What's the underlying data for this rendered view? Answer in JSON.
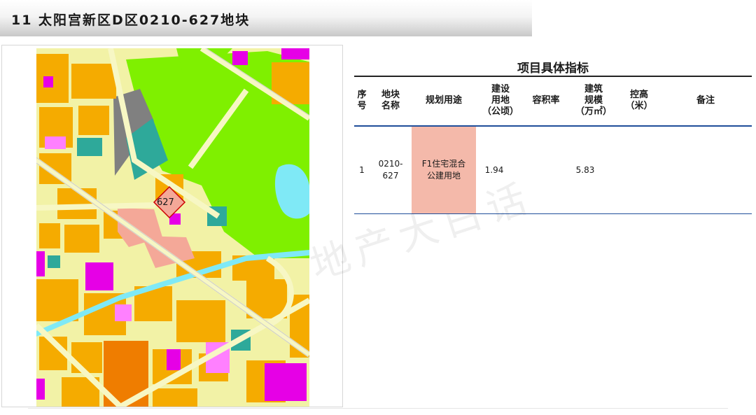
{
  "header": {
    "title": "11  太阳宫新区D区0210-627地块"
  },
  "map": {
    "parcel_label": "627",
    "colors": {
      "residential": "#f5ab00",
      "green_space": "#7ff000",
      "commercial": "#e600e6",
      "mixed_use": "#f4a898",
      "education": "#ff80ff",
      "municipal": "#2ea99a",
      "industrial": "#808080",
      "water": "#7fe9f6",
      "road": "#f2f2a6"
    }
  },
  "watermark": "地产大白话",
  "table": {
    "title": "项目具体指标",
    "headers": [
      "序\n号",
      "地块\n名称",
      "规划用途",
      "建设\n用地\n（公顷）",
      "容积率",
      "建筑\n规模\n（万㎡）",
      "控高\n（米）",
      "备注"
    ],
    "rows": [
      {
        "no": "1",
        "name": "0210-\n627",
        "use": "F1住宅混合\n公建用地",
        "area": "1.94",
        "far": "",
        "scale": "5.83",
        "height": "",
        "note": ""
      }
    ]
  }
}
